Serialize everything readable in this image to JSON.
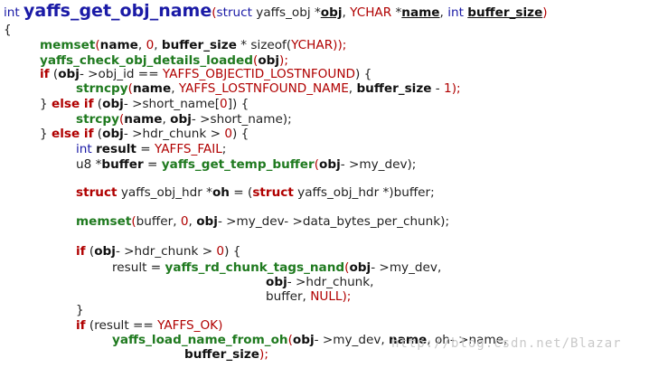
{
  "lines": [
    {
      "tokens": [
        [
          "int ",
          "plain-kw"
        ],
        [
          "yaffs_get_obj_name",
          "fn-title"
        ],
        [
          "(",
          "punc"
        ],
        [
          "struct",
          "kw-plain"
        ],
        [
          " yaffs_obj ",
          "id"
        ],
        [
          "*",
          "op"
        ],
        [
          "obj",
          "ubold-id"
        ],
        [
          ", ",
          "op"
        ],
        [
          "YCHAR",
          "const"
        ],
        [
          " *",
          "op"
        ],
        [
          "name",
          "ubold-id"
        ],
        [
          ", ",
          "op"
        ],
        [
          "int",
          "plain-kw"
        ],
        [
          " ",
          "op"
        ],
        [
          "buffer_size",
          "ubold-id"
        ],
        [
          ")",
          "punc"
        ]
      ]
    },
    {
      "tokens": [
        [
          "{",
          "brace"
        ]
      ]
    },
    {
      "tokens": [
        [
          "memset",
          "fn"
        ],
        [
          "(",
          "punc"
        ],
        [
          "name",
          "bold-id"
        ],
        [
          ", ",
          "op"
        ],
        [
          "0",
          "num"
        ],
        [
          ", ",
          "op"
        ],
        [
          "buffer_size",
          "bold-id"
        ],
        [
          " * sizeof(",
          "op"
        ],
        [
          "YCHAR",
          "const"
        ],
        [
          "));",
          "punc"
        ]
      ]
    },
    {
      "tokens": [
        [
          "yaffs_check_obj_details_loaded",
          "fn"
        ],
        [
          "(",
          "punc"
        ],
        [
          "obj",
          "bold-id"
        ],
        [
          ");",
          "punc"
        ]
      ]
    },
    {
      "tokens": [
        [
          "if",
          "kw"
        ],
        [
          " (",
          "op"
        ],
        [
          "obj",
          "bold-id"
        ],
        [
          "- >obj_id == ",
          "op"
        ],
        [
          "YAFFS_OBJECTID_LOSTNFOUND",
          "const"
        ],
        [
          ") {",
          "op"
        ]
      ]
    },
    {
      "tokens": [
        [
          "strncpy",
          "fn"
        ],
        [
          "(",
          "punc"
        ],
        [
          "name",
          "bold-id"
        ],
        [
          ", ",
          "op"
        ],
        [
          "YAFFS_LOSTNFOUND_NAME",
          "const"
        ],
        [
          ", ",
          "op"
        ],
        [
          "buffer_size",
          "bold-id"
        ],
        [
          " - ",
          "op"
        ],
        [
          "1",
          "num"
        ],
        [
          ");",
          "punc"
        ]
      ]
    },
    {
      "tokens": [
        [
          "} ",
          "brace"
        ],
        [
          "else if",
          "kw"
        ],
        [
          " (",
          "op"
        ],
        [
          "obj",
          "bold-id"
        ],
        [
          "- >short_name[",
          "op"
        ],
        [
          "0",
          "num"
        ],
        [
          "]) {",
          "op"
        ]
      ]
    },
    {
      "tokens": [
        [
          "strcpy",
          "fn"
        ],
        [
          "(",
          "punc"
        ],
        [
          "name",
          "bold-id"
        ],
        [
          ", ",
          "op"
        ],
        [
          "obj",
          "bold-id"
        ],
        [
          "- >short_name);",
          "op"
        ]
      ]
    },
    {
      "tokens": [
        [
          "} ",
          "brace"
        ],
        [
          "else if",
          "kw"
        ],
        [
          " (",
          "op"
        ],
        [
          "obj",
          "bold-id"
        ],
        [
          "- >hdr_chunk > ",
          "op"
        ],
        [
          "0",
          "num"
        ],
        [
          ") {",
          "op"
        ]
      ]
    },
    {
      "tokens": [
        [
          "int",
          "plain-kw"
        ],
        [
          " ",
          "op"
        ],
        [
          "result",
          "bold-id"
        ],
        [
          " = ",
          "op"
        ],
        [
          "YAFFS_FAIL",
          "const"
        ],
        [
          ";",
          "op"
        ]
      ]
    },
    {
      "tokens": [
        [
          "u8 *",
          "id"
        ],
        [
          "buffer",
          "bold-id"
        ],
        [
          " = ",
          "op"
        ],
        [
          "yaffs_get_temp_buffer",
          "fn"
        ],
        [
          "(",
          "punc"
        ],
        [
          "obj",
          "bold-id"
        ],
        [
          "- >my_dev);",
          "op"
        ]
      ]
    },
    {
      "tokens": []
    },
    {
      "tokens": [
        [
          "struct",
          "kw"
        ],
        [
          " yaffs_obj_hdr *",
          "id"
        ],
        [
          "oh",
          "bold-id"
        ],
        [
          " = (",
          "op"
        ],
        [
          "struct",
          "kw"
        ],
        [
          " yaffs_obj_hdr *)buffer;",
          "id"
        ]
      ]
    },
    {
      "tokens": []
    },
    {
      "tokens": [
        [
          "memset",
          "fn"
        ],
        [
          "(",
          "punc"
        ],
        [
          "buffer, ",
          "id"
        ],
        [
          "0",
          "num"
        ],
        [
          ", ",
          "op"
        ],
        [
          "obj",
          "bold-id"
        ],
        [
          "- >my_dev- >data_bytes_per_chunk);",
          "op"
        ]
      ]
    },
    {
      "tokens": []
    },
    {
      "tokens": [
        [
          "if",
          "kw"
        ],
        [
          " (",
          "op"
        ],
        [
          "obj",
          "bold-id"
        ],
        [
          "- >hdr_chunk > ",
          "op"
        ],
        [
          "0",
          "num"
        ],
        [
          ") {",
          "op"
        ]
      ]
    },
    {
      "tokens": [
        [
          "result = ",
          "id"
        ],
        [
          "yaffs_rd_chunk_tags_nand",
          "fn"
        ],
        [
          "(",
          "punc"
        ],
        [
          "obj",
          "bold-id"
        ],
        [
          "- >my_dev,",
          "op"
        ]
      ]
    },
    {
      "tokens": [
        [
          "obj",
          "bold-id"
        ],
        [
          "- >hdr_chunk,",
          "op"
        ]
      ]
    },
    {
      "tokens": [
        [
          "buffer, ",
          "id"
        ],
        [
          "NULL",
          "const"
        ],
        [
          ");",
          "punc"
        ]
      ]
    },
    {
      "tokens": [
        [
          "}",
          "brace"
        ]
      ]
    },
    {
      "tokens": [
        [
          "if",
          "kw"
        ],
        [
          " (result == ",
          "id"
        ],
        [
          "YAFFS_OK",
          "const"
        ],
        [
          ")",
          "punc"
        ]
      ]
    },
    {
      "tokens": [
        [
          "yaffs_load_name_from_oh",
          "fn"
        ],
        [
          "(",
          "punc"
        ],
        [
          "obj",
          "bold-id"
        ],
        [
          "- >my_dev, ",
          "op"
        ],
        [
          "name",
          "bold-id"
        ],
        [
          ", oh- >name,",
          "op"
        ]
      ]
    },
    {
      "tokens": [
        [
          "buffer_size",
          "bold-id"
        ],
        [
          ");",
          "punc"
        ]
      ]
    }
  ],
  "watermark": "http://blog.csdn.net/Blazar"
}
